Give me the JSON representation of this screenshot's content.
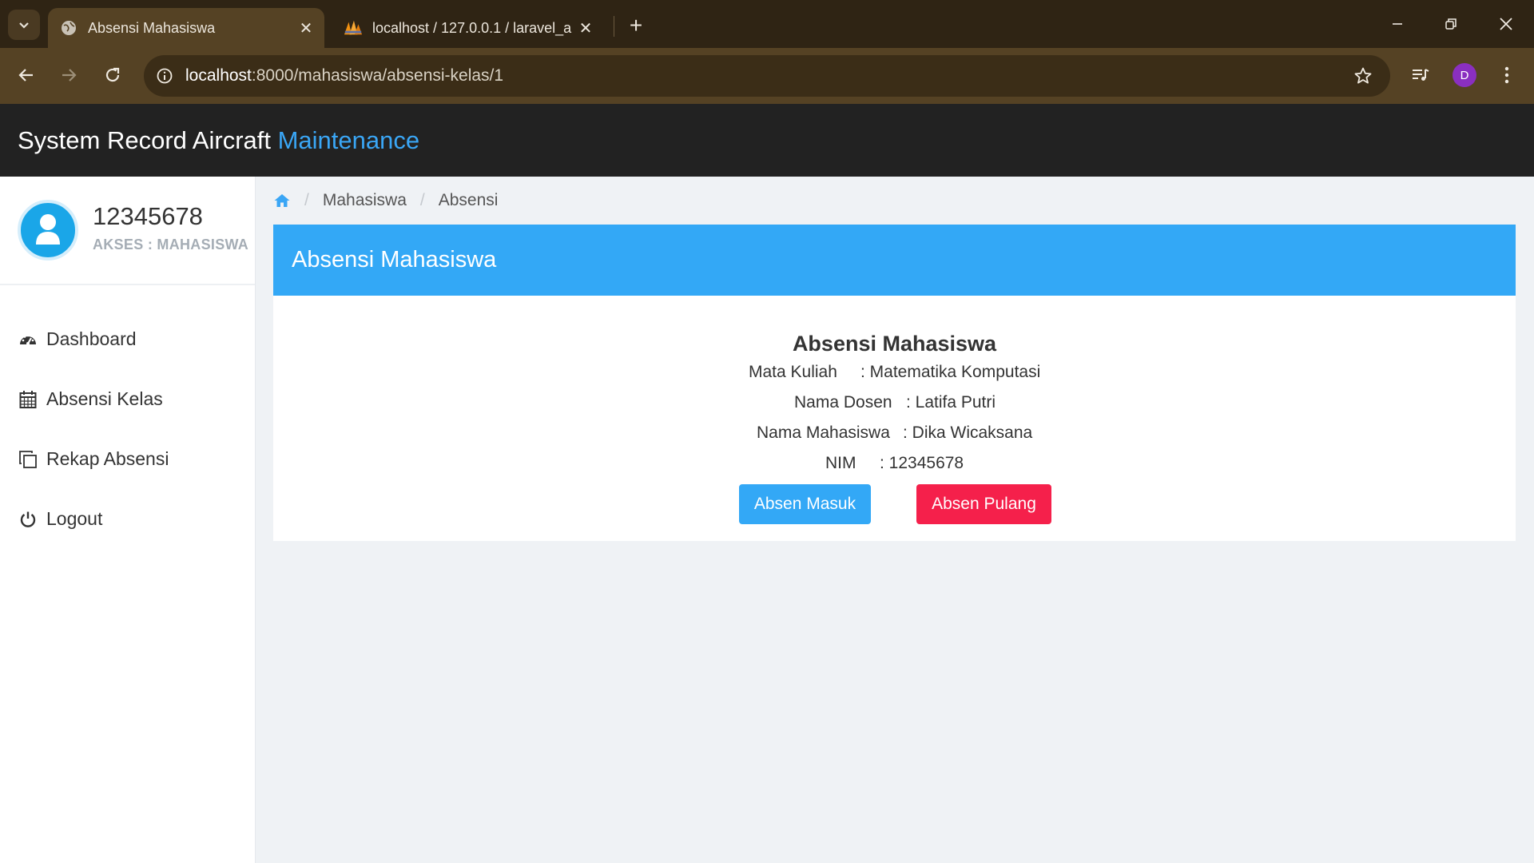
{
  "browser": {
    "tabs": [
      {
        "title": "Absensi Mahasiswa",
        "active": true,
        "icon": "globe-icon"
      },
      {
        "title": "localhost / 127.0.0.1 / laravel_ab",
        "active": false,
        "icon": "phpmyadmin-icon"
      }
    ],
    "url": {
      "host": "localhost",
      "path": ":8000/mahasiswa/absensi-kelas/1"
    },
    "profile_initial": "D"
  },
  "header": {
    "title_main": "System Record Aircraft ",
    "title_accent": "Maintenance",
    "accent_color": "#3aa6f5"
  },
  "sidebar": {
    "user": {
      "name": "12345678",
      "role": "AKSES : MAHASISWA"
    },
    "items": [
      {
        "label": "Dashboard",
        "icon": "dashboard-icon"
      },
      {
        "label": "Absensi Kelas",
        "icon": "calendar-icon"
      },
      {
        "label": "Rekap Absensi",
        "icon": "copy-icon"
      },
      {
        "label": "Logout",
        "icon": "power-icon"
      }
    ]
  },
  "breadcrumb": {
    "items": [
      "Mahasiswa",
      "Absensi"
    ]
  },
  "card": {
    "header": "Absensi Mahasiswa",
    "title": "Absensi Mahasiswa",
    "rows": {
      "mata_kuliah": {
        "label": "Mata Kuliah",
        "value": ": Matematika Komputasi"
      },
      "dosen": {
        "label": "Nama Dosen",
        "value": ": Latifa Putri"
      },
      "mahasiswa": {
        "label": "Nama Mahasiswa",
        "value": ": Dika Wicaksana"
      },
      "nim": {
        "label": "NIM",
        "value": ": 12345678"
      }
    },
    "buttons": {
      "masuk": "Absen Masuk",
      "pulang": "Absen Pulang"
    },
    "colors": {
      "masuk": "#33a8f6",
      "pulang": "#f5204b"
    }
  }
}
